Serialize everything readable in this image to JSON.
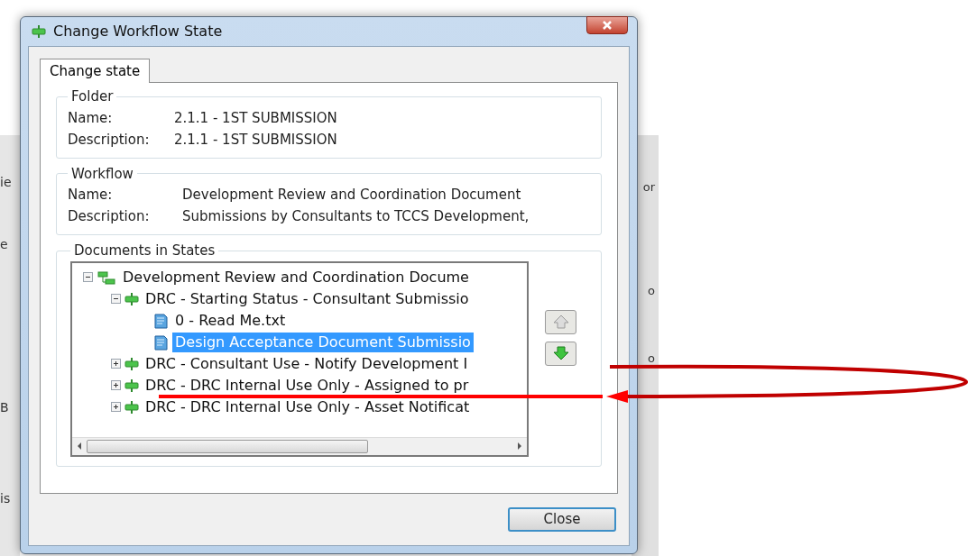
{
  "background_fragments": {
    "left": [
      "ie",
      "e",
      "B",
      "is"
    ],
    "right": [
      "or",
      "o",
      "o"
    ]
  },
  "window": {
    "title": "Change Workflow State"
  },
  "tabs": [
    {
      "label": "Change state",
      "selected": true
    }
  ],
  "folder": {
    "title": "Folder",
    "fields": [
      {
        "label": "Name:",
        "value": "2.1.1 - 1ST SUBMISSION"
      },
      {
        "label": "Description:",
        "value": "2.1.1 - 1ST SUBMISSION"
      }
    ]
  },
  "workflow": {
    "title": "Workflow",
    "fields": [
      {
        "label": "Name:",
        "value": "Development Review and Coordination Document"
      },
      {
        "label": "Description:",
        "value": "Submissions by Consultants to TCCS Development,"
      }
    ]
  },
  "documents": {
    "title": "Documents in States",
    "tree": [
      {
        "kind": "workflow",
        "label": "Development Review and Coordination Docume",
        "expanded": true,
        "selected": false,
        "children": [
          {
            "kind": "state",
            "label": "DRC - Starting Status - Consultant Submissio",
            "expanded": true,
            "selected": false,
            "children": [
              {
                "kind": "document",
                "label": "0 - Read Me.txt",
                "selected": false
              },
              {
                "kind": "document",
                "label": "Design Acceptance Document Submissio",
                "selected": true
              }
            ]
          },
          {
            "kind": "state",
            "label": "DRC - Consultant Use - Notify Development I",
            "expanded": false,
            "selected": false
          },
          {
            "kind": "state",
            "label": "DRC - DRC Internal Use Only - Assigned to pr",
            "expanded": false,
            "selected": false
          },
          {
            "kind": "state",
            "label": "DRC - DRC Internal Use Only - Asset Notificat",
            "expanded": false,
            "selected": false
          }
        ]
      }
    ],
    "move_up": {
      "disabled": true
    },
    "move_down": {
      "disabled": false
    }
  },
  "buttons": [
    "Close"
  ]
}
